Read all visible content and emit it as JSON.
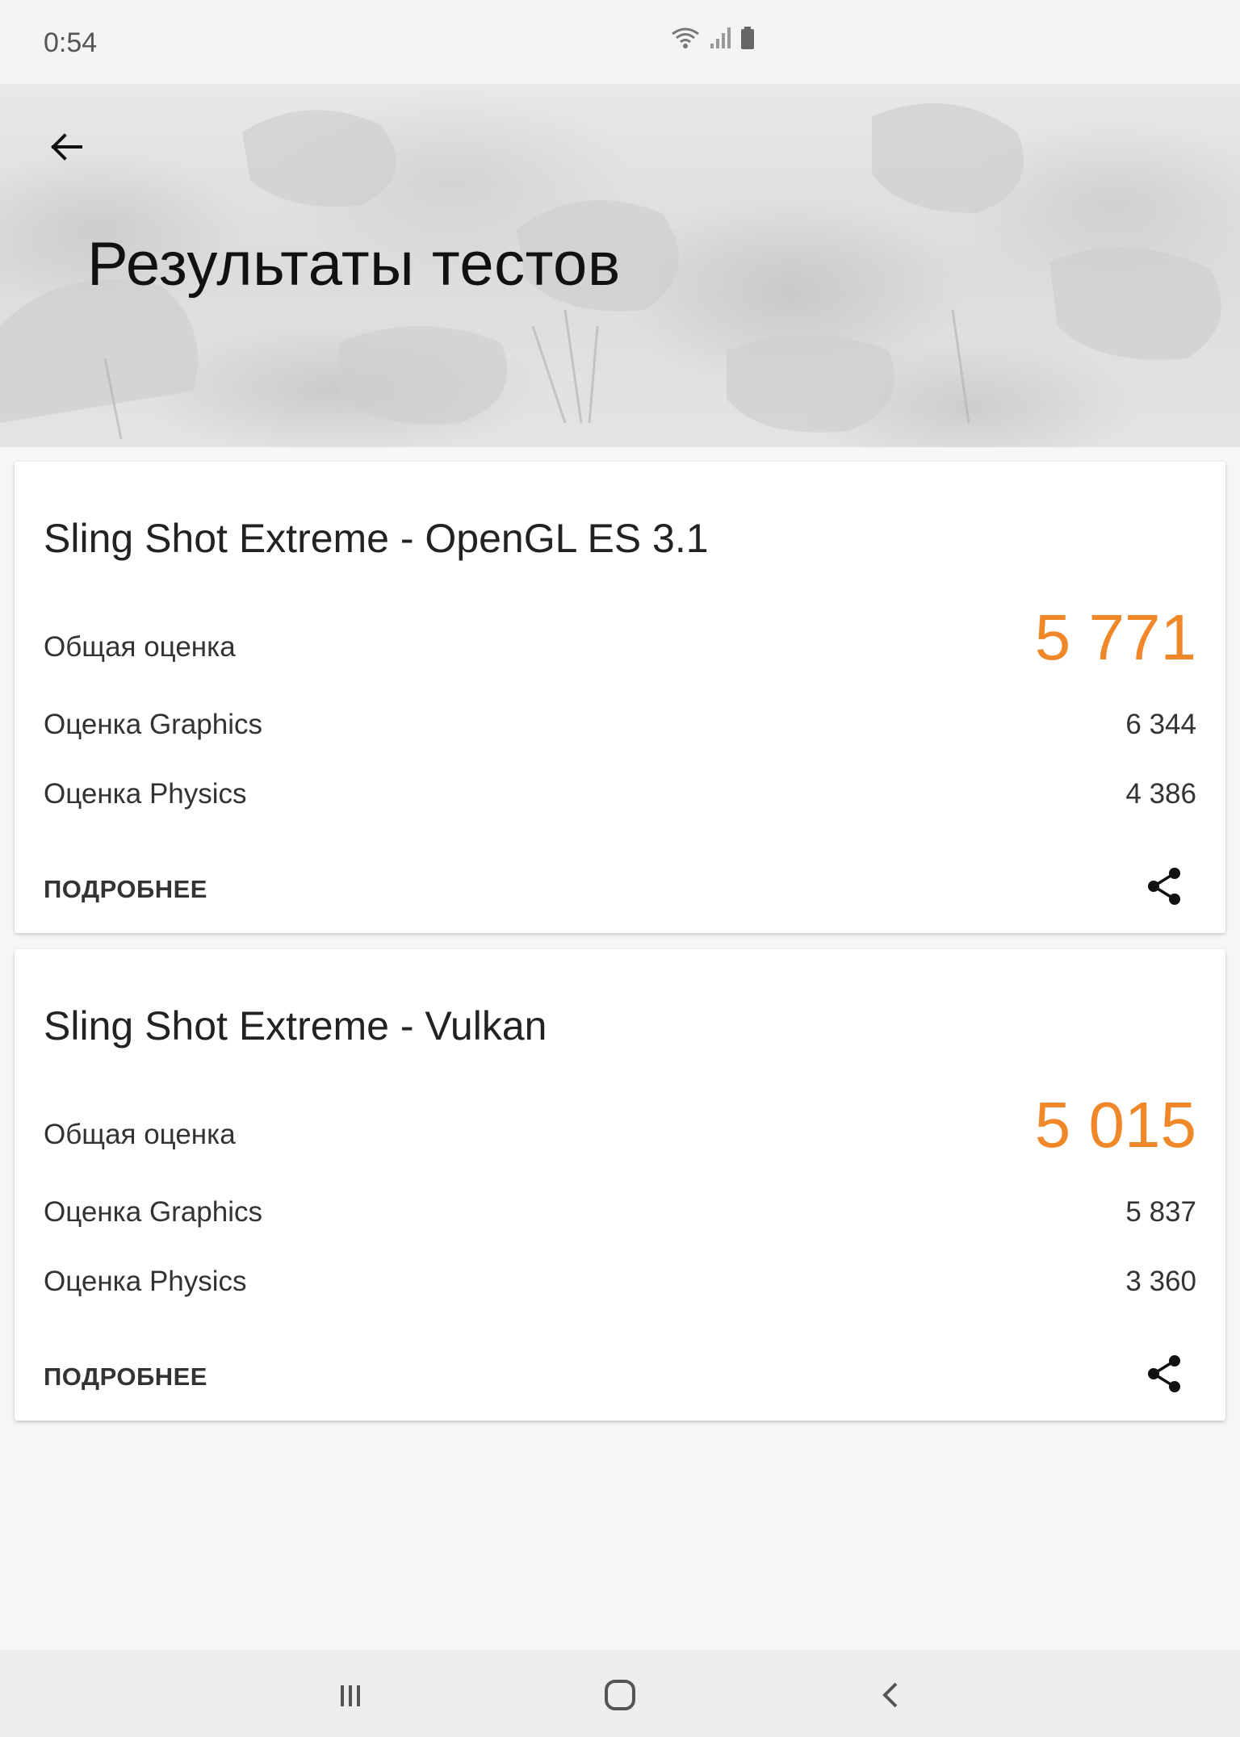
{
  "status_bar": {
    "time": "0:54",
    "icons": [
      "wifi-icon",
      "signal-icon",
      "battery-icon"
    ]
  },
  "header": {
    "title": "Результаты тестов",
    "back_icon": "arrow-back-icon"
  },
  "colors": {
    "accent": "#f0882a",
    "background": "#f6f6f6",
    "card": "#ffffff"
  },
  "results": [
    {
      "title": "Sling Shot Extreme - OpenGL ES 3.1",
      "overall_label": "Общая оценка",
      "overall_value": "5 771",
      "graphics_label": "Оценка Graphics",
      "graphics_value": "6 344",
      "physics_label": "Оценка Physics",
      "physics_value": "4 386",
      "details_label": "ПОДРОБНЕЕ",
      "share_icon": "share-icon"
    },
    {
      "title": "Sling Shot Extreme - Vulkan",
      "overall_label": "Общая оценка",
      "overall_value": "5 015",
      "graphics_label": "Оценка Graphics",
      "graphics_value": "5 837",
      "physics_label": "Оценка Physics",
      "physics_value": "3 360",
      "details_label": "ПОДРОБНЕЕ",
      "share_icon": "share-icon"
    }
  ],
  "nav_bar": {
    "buttons": [
      "recents-icon",
      "home-icon",
      "back-icon"
    ]
  }
}
